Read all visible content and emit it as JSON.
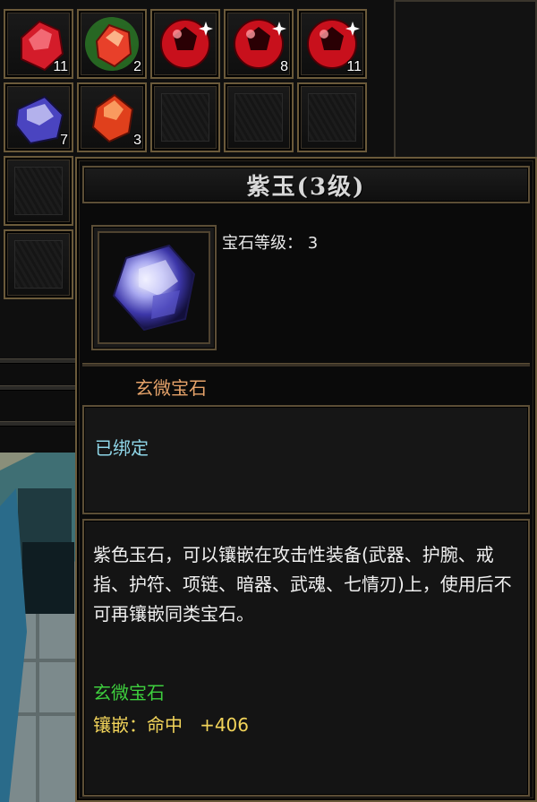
{
  "colors": {
    "frame": "#6b5a3a",
    "title_text": "#d8d8d8",
    "category_text": "#e6a36a",
    "bound_text": "#8fd6e8",
    "set_text": "#3ecf3e",
    "attr_text": "#f2d45a"
  },
  "inventory": {
    "slots": [
      {
        "gem": "red-gem-icon",
        "count": "11"
      },
      {
        "gem": "green-red-gem-icon",
        "count": "2"
      },
      {
        "gem": "red-round-gem-icon",
        "count": ""
      },
      {
        "gem": "red-round-gem-icon",
        "count": "8"
      },
      {
        "gem": "red-round-gem-icon",
        "count": "11"
      },
      {
        "gem": "purple-gem-icon",
        "count": "7"
      },
      {
        "gem": "orange-gem-icon",
        "count": "3"
      },
      {
        "gem": "empty",
        "count": ""
      },
      {
        "gem": "empty",
        "count": ""
      },
      {
        "gem": "empty",
        "count": ""
      },
      {
        "gem": "empty",
        "count": ""
      },
      {
        "gem": "empty",
        "count": ""
      }
    ]
  },
  "tooltip": {
    "title": "紫玉(3级)",
    "level_label": "宝石等级：",
    "level_value": "3",
    "category": "玄微宝石",
    "bound": "已绑定",
    "description": "紫色玉石，可以镶嵌在攻击性装备(武器、护腕、戒指、护符、项链、暗器、武魂、七情刃)上，使用后不可再镶嵌同类宝石。",
    "set_name": "玄微宝石",
    "attr_label": "镶嵌：命中",
    "attr_value": "+406"
  }
}
